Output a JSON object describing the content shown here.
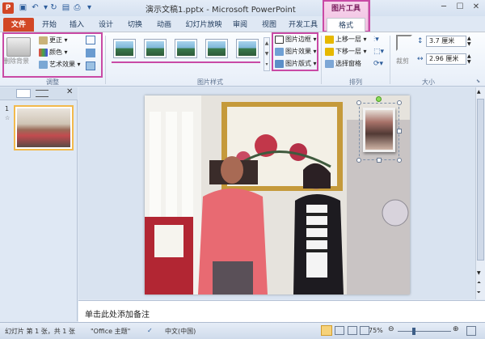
{
  "window": {
    "title": "演示文稿1.pptx - Microsoft PowerPoint",
    "app_logo": "P",
    "context_tab_group": "图片工具"
  },
  "tabs": [
    {
      "label": "文件"
    },
    {
      "label": "开始"
    },
    {
      "label": "插入"
    },
    {
      "label": "设计"
    },
    {
      "label": "切换"
    },
    {
      "label": "动画"
    },
    {
      "label": "幻灯片放映"
    },
    {
      "label": "审阅"
    },
    {
      "label": "视图"
    },
    {
      "label": "开发工具"
    },
    {
      "label": "格式"
    }
  ],
  "ribbon": {
    "adjust": {
      "label": "调整",
      "remove_bg": "删除背景",
      "corrections": "更正",
      "color": "颜色",
      "artistic": "艺术效果"
    },
    "picture_styles": {
      "label": "图片样式",
      "border": "图片边框",
      "effects": "图片效果",
      "layout": "图片版式"
    },
    "arrange": {
      "label": "排列",
      "bring_forward": "上移一层",
      "send_backward": "下移一层",
      "selection_pane": "选择窗格"
    },
    "size": {
      "label": "大小",
      "crop": "裁剪",
      "height": "3.7 厘米",
      "width": "2.96 厘米"
    }
  },
  "left_pane": {
    "slide_number": "1"
  },
  "notes": {
    "placeholder": "单击此处添加备注"
  },
  "status": {
    "slide": "幻灯片 第 1 张，共 1 张",
    "theme": "\"Office 主题\"",
    "language": "中文(中国)",
    "zoom": "75%"
  },
  "colors": {
    "accent_file": "#d24726",
    "context_pink": "#c94aa5",
    "ribbon_text": "#1e395b"
  }
}
